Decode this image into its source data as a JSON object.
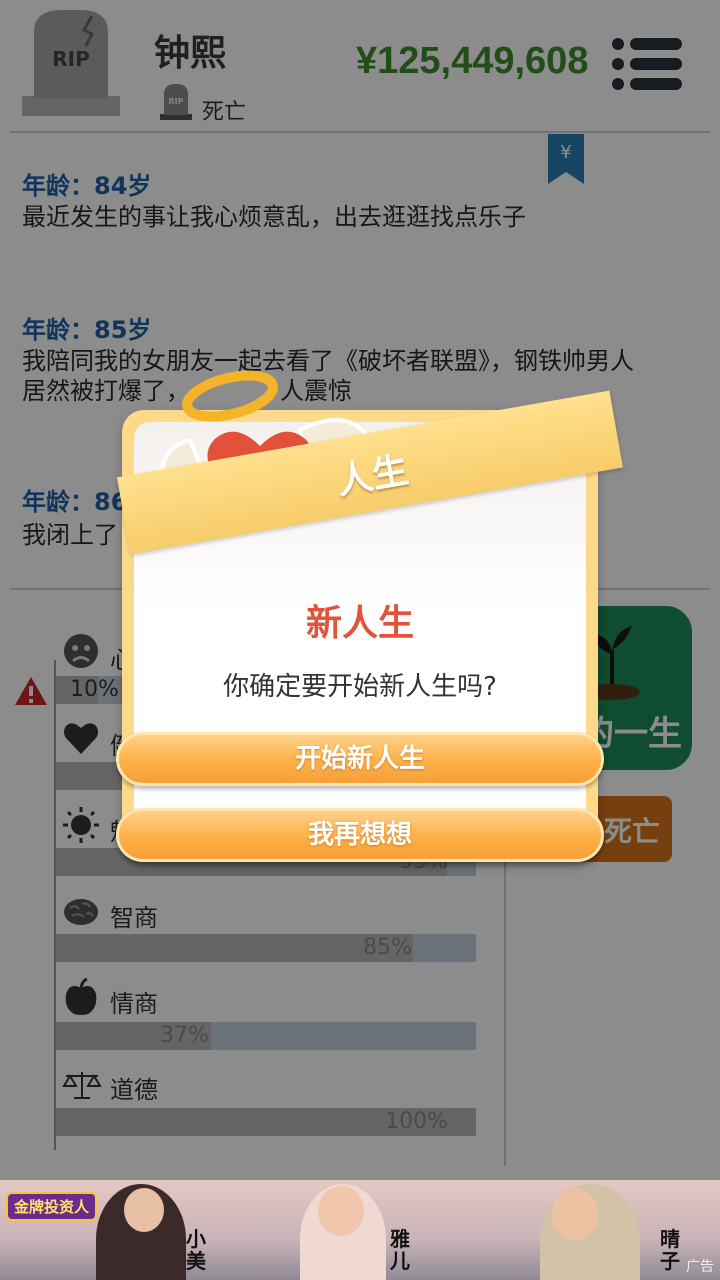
{
  "header": {
    "tomb_text": "RIP",
    "name": "钟熙",
    "status_badge_text": "RIP",
    "status": "死亡",
    "money": "¥125,449,608"
  },
  "bookmark_symbol": "¥",
  "log": [
    {
      "age": "年龄：84岁",
      "text": "最近发生的事让我心烦意乱，出去逛逛找点乐子"
    },
    {
      "age": "年龄：85岁",
      "text_line1": "我陪同我的女朋友一起去看了《破坏者联盟》，钢铁帅男人",
      "text_line2": "居然被打爆了，",
      "text_line2_end": "人震惊"
    },
    {
      "age": "年龄：86",
      "text": "我闭上了"
    }
  ],
  "stats": [
    {
      "icon": "sad-face-icon",
      "label": "心",
      "value_text": "10%",
      "value": 10
    },
    {
      "icon": "heart-icon",
      "label": "健",
      "value_text": "",
      "value": null
    },
    {
      "icon": "sun-icon",
      "label": "魅",
      "value_text": "93%",
      "value": 93
    },
    {
      "icon": "brain-icon",
      "label": "智商",
      "value_text": "85%",
      "value": 85
    },
    {
      "icon": "apple-icon",
      "label": "情商",
      "value_text": "37%",
      "value": 37
    },
    {
      "icon": "scale-icon",
      "label": "道德",
      "value_text": "100%",
      "value": 100
    }
  ],
  "next_life_label": "的一生",
  "death_label": "死亡",
  "dialog": {
    "ribbon_label": "人生",
    "title": "新人生",
    "message": "你确定要开始新人生吗?",
    "confirm_label": "开始新人生",
    "cancel_label": "我再想想"
  },
  "ad": {
    "brand": "金牌投资人",
    "names": [
      "小美",
      "雅儿",
      "晴子"
    ],
    "tag": "广告"
  },
  "colors": {
    "money": "#3e8a2c",
    "age_label": "#1f5fa8",
    "dialog_title": "#e2533a",
    "button_orange": "#ffb046",
    "next_life_green": "#1e8a5a",
    "death_orange": "#d6751b"
  }
}
